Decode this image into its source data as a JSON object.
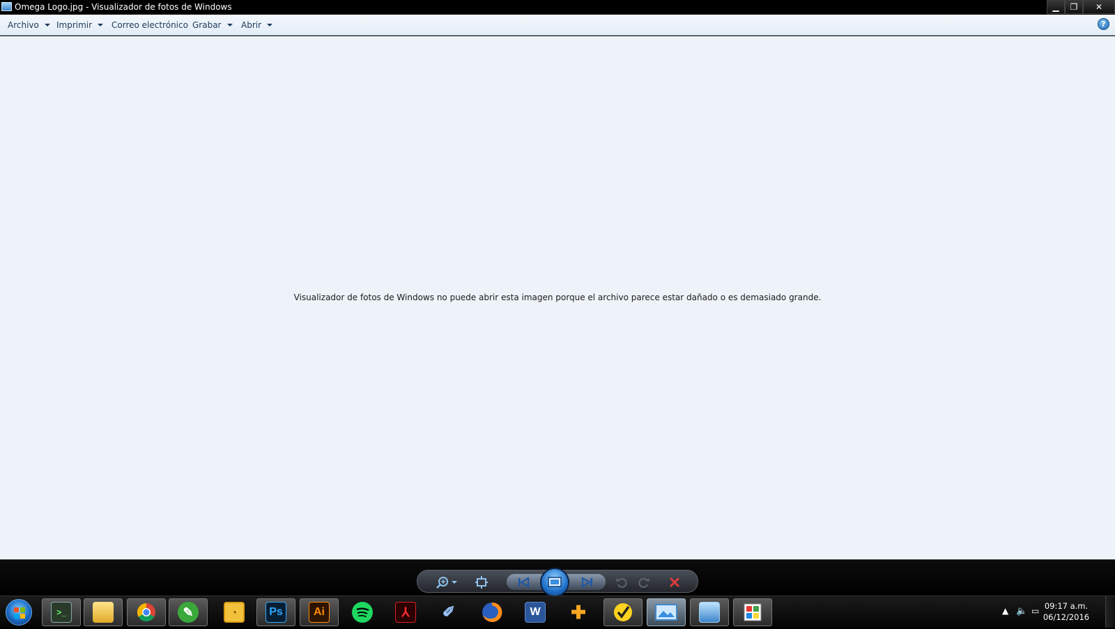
{
  "window": {
    "title": "Omega Logo.jpg - Visualizador de fotos de Windows",
    "controls": {
      "minimize": "▁",
      "maximize": "❐",
      "close": "✕"
    }
  },
  "menubar": {
    "items": [
      {
        "label": "Archivo",
        "has_dropdown": true
      },
      {
        "label": "Imprimir",
        "has_dropdown": true
      },
      {
        "label": "Correo electrónico",
        "has_dropdown": false
      },
      {
        "label": "Grabar",
        "has_dropdown": true
      },
      {
        "label": "Abrir",
        "has_dropdown": true
      }
    ],
    "help_label": "?"
  },
  "viewer": {
    "error_message": "Visualizador de fotos de Windows no puede abrir esta imagen porque el archivo parece estar dañado o es demasiado grande."
  },
  "controls": {
    "icons": [
      "zoom-icon",
      "fit-window-icon",
      "previous-icon",
      "slideshow-icon",
      "next-icon",
      "rotate-left-icon",
      "rotate-right-icon",
      "delete-icon"
    ],
    "colors": {
      "accent": "#1f6fc8",
      "delete": "#e03a3a"
    }
  },
  "taskbar": {
    "apps": [
      {
        "name": "terminal",
        "icon": "terminal-icon",
        "label": ""
      },
      {
        "name": "explorer",
        "icon": "folder-icon",
        "label": ""
      },
      {
        "name": "chrome",
        "icon": "chrome-icon",
        "label": ""
      },
      {
        "name": "green-app",
        "icon": "leaf-icon",
        "label": ""
      },
      {
        "name": "yellow-app",
        "icon": "chart-icon",
        "label": ""
      },
      {
        "name": "photoshop",
        "icon": "photoshop-icon",
        "label": "Ps"
      },
      {
        "name": "illustrator",
        "icon": "illustrator-icon",
        "label": "Ai"
      },
      {
        "name": "spotify",
        "icon": "spotify-icon",
        "label": ""
      },
      {
        "name": "acrobat",
        "icon": "acrobat-icon",
        "label": ""
      },
      {
        "name": "blue-app",
        "icon": "tools-icon",
        "label": ""
      },
      {
        "name": "firefox",
        "icon": "firefox-icon",
        "label": ""
      },
      {
        "name": "word",
        "icon": "word-icon",
        "label": "W"
      },
      {
        "name": "orange-app",
        "icon": "puzzle-icon",
        "label": ""
      },
      {
        "name": "norton",
        "icon": "checkmark-icon",
        "label": ""
      },
      {
        "name": "photo-viewer",
        "icon": "photo-viewer-icon",
        "label": ""
      },
      {
        "name": "control-panel",
        "icon": "control-panel-icon",
        "label": ""
      },
      {
        "name": "paint",
        "icon": "paint-icon",
        "label": ""
      }
    ],
    "tray": {
      "time": "09:17 a.m.",
      "date": "06/12/2016"
    }
  }
}
